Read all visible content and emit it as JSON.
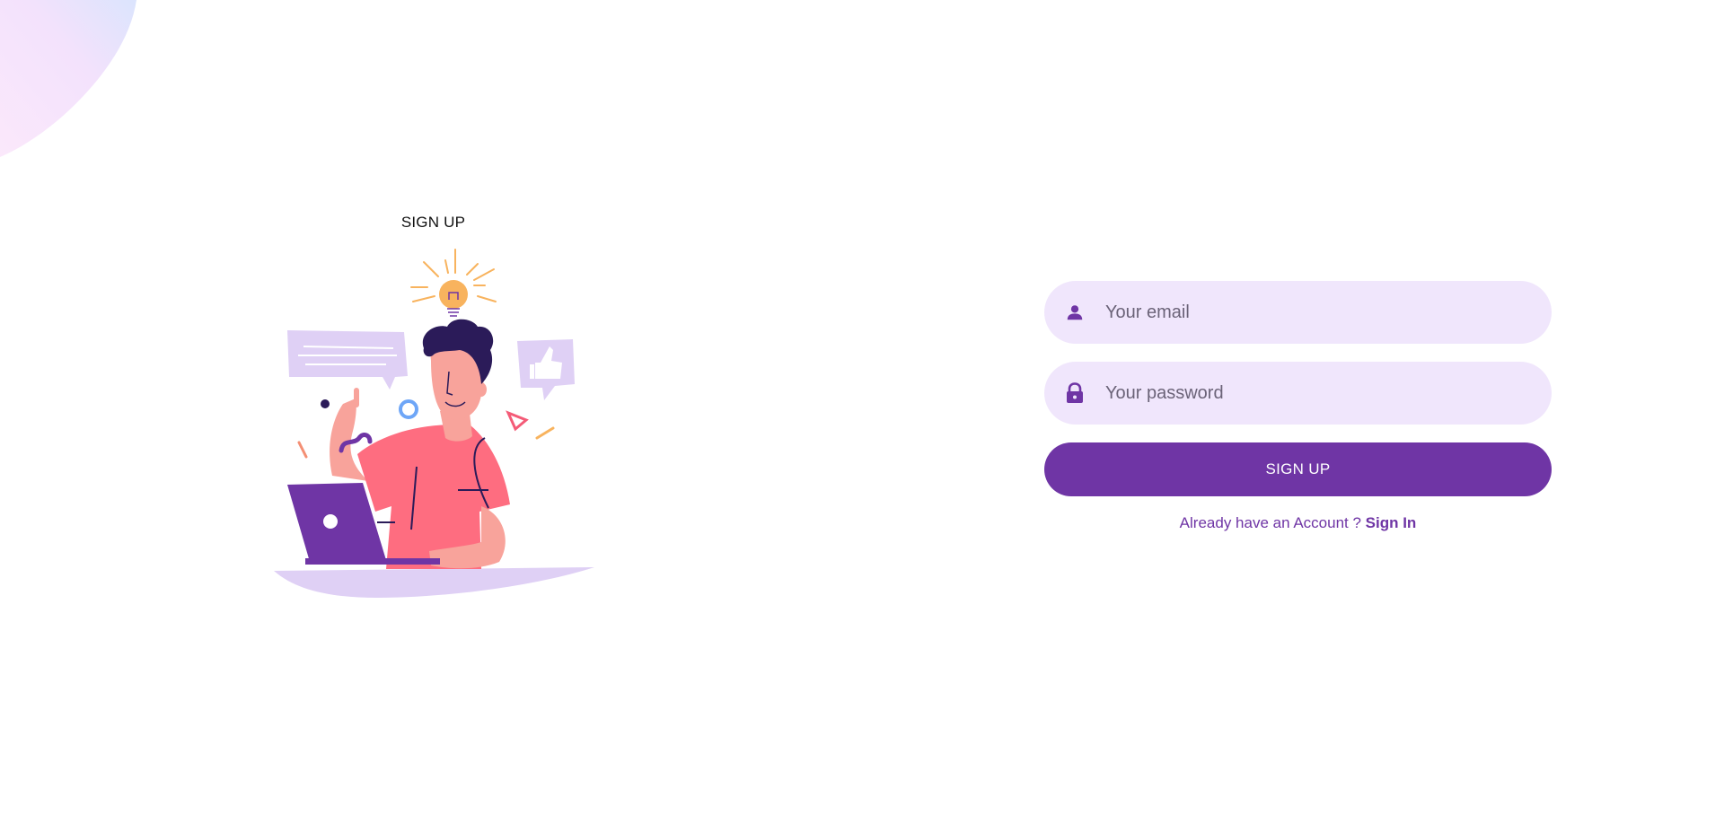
{
  "page": {
    "colors": {
      "primary": "#6f35a5",
      "primary_light": "#f0e6fc",
      "background": "#ffffff"
    }
  },
  "illustration": {
    "heading": "SIGN UP",
    "image_name": "person-with-laptop-idea-illustration"
  },
  "form": {
    "email": {
      "placeholder": "Your email",
      "value": "",
      "icon": "person-icon"
    },
    "password": {
      "placeholder": "Your password",
      "value": "",
      "icon": "lock-icon"
    },
    "submit_label": "SIGN UP",
    "account_prompt": "Already have an Account ?",
    "sign_in_label": "Sign In"
  }
}
